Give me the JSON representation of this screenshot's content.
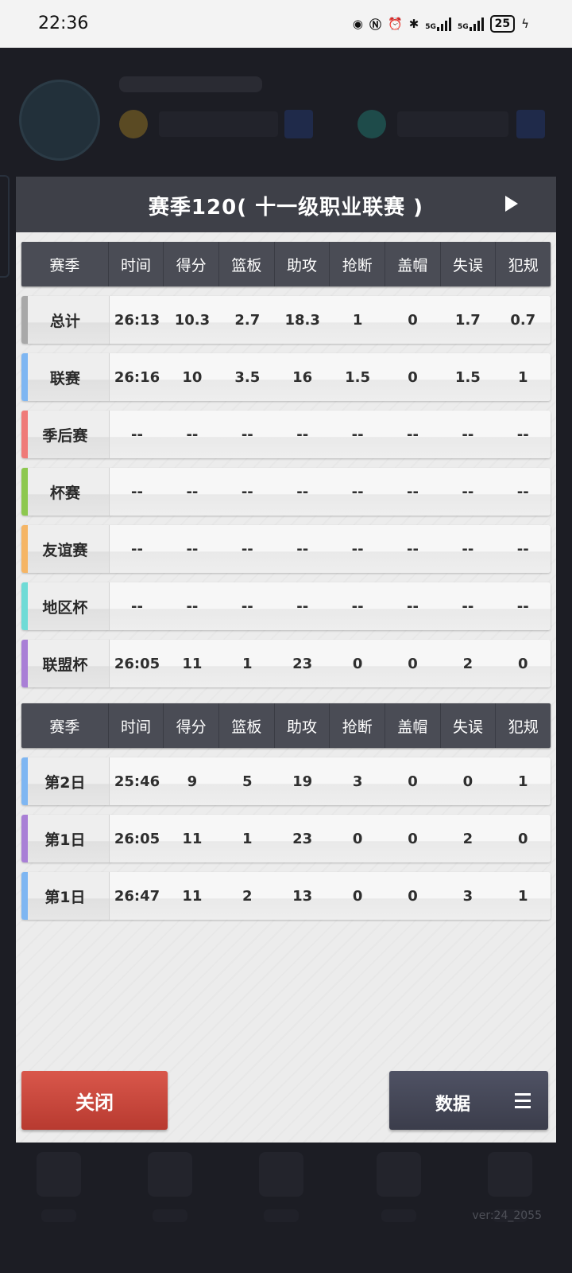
{
  "status_bar": {
    "time": "22:36",
    "battery": "25",
    "network1": "5G",
    "network2": "5G"
  },
  "app_version": "ver:24_2055",
  "dialog": {
    "title": "赛季120( 十一级职业联赛 )",
    "close_label": "关闭",
    "data_label": "数据"
  },
  "season_table": {
    "headers": [
      "赛季",
      "时间",
      "得分",
      "篮板",
      "助攻",
      "抢断",
      "盖帽",
      "失误",
      "犯规"
    ],
    "rows": [
      {
        "label": "总计",
        "accent": "#a8a8a8",
        "values": [
          "26:13",
          "10.3",
          "2.7",
          "18.3",
          "1",
          "0",
          "1.7",
          "0.7"
        ]
      },
      {
        "label": "联赛",
        "accent": "#7eb6f2",
        "values": [
          "26:16",
          "10",
          "3.5",
          "16",
          "1.5",
          "0",
          "1.5",
          "1"
        ]
      },
      {
        "label": "季后赛",
        "accent": "#ef7a78",
        "values": [
          "--",
          "--",
          "--",
          "--",
          "--",
          "--",
          "--",
          "--"
        ]
      },
      {
        "label": "杯赛",
        "accent": "#8dc84f",
        "values": [
          "--",
          "--",
          "--",
          "--",
          "--",
          "--",
          "--",
          "--"
        ]
      },
      {
        "label": "友谊赛",
        "accent": "#f5b565",
        "values": [
          "--",
          "--",
          "--",
          "--",
          "--",
          "--",
          "--",
          "--"
        ]
      },
      {
        "label": "地区杯",
        "accent": "#6fdbd6",
        "values": [
          "--",
          "--",
          "--",
          "--",
          "--",
          "--",
          "--",
          "--"
        ]
      },
      {
        "label": "联盟杯",
        "accent": "#a97fd6",
        "values": [
          "26:05",
          "11",
          "1",
          "23",
          "0",
          "0",
          "2",
          "0"
        ]
      }
    ]
  },
  "game_table": {
    "headers": [
      "赛季",
      "时间",
      "得分",
      "篮板",
      "助攻",
      "抢断",
      "盖帽",
      "失误",
      "犯规"
    ],
    "rows": [
      {
        "label": "第2日",
        "accent": "#7eb6f2",
        "values": [
          "25:46",
          "9",
          "5",
          "19",
          "3",
          "0",
          "0",
          "1"
        ]
      },
      {
        "label": "第1日",
        "accent": "#a97fd6",
        "values": [
          "26:05",
          "11",
          "1",
          "23",
          "0",
          "0",
          "2",
          "0"
        ]
      },
      {
        "label": "第1日",
        "accent": "#7eb6f2",
        "values": [
          "26:47",
          "11",
          "2",
          "13",
          "0",
          "0",
          "3",
          "1"
        ]
      }
    ]
  }
}
